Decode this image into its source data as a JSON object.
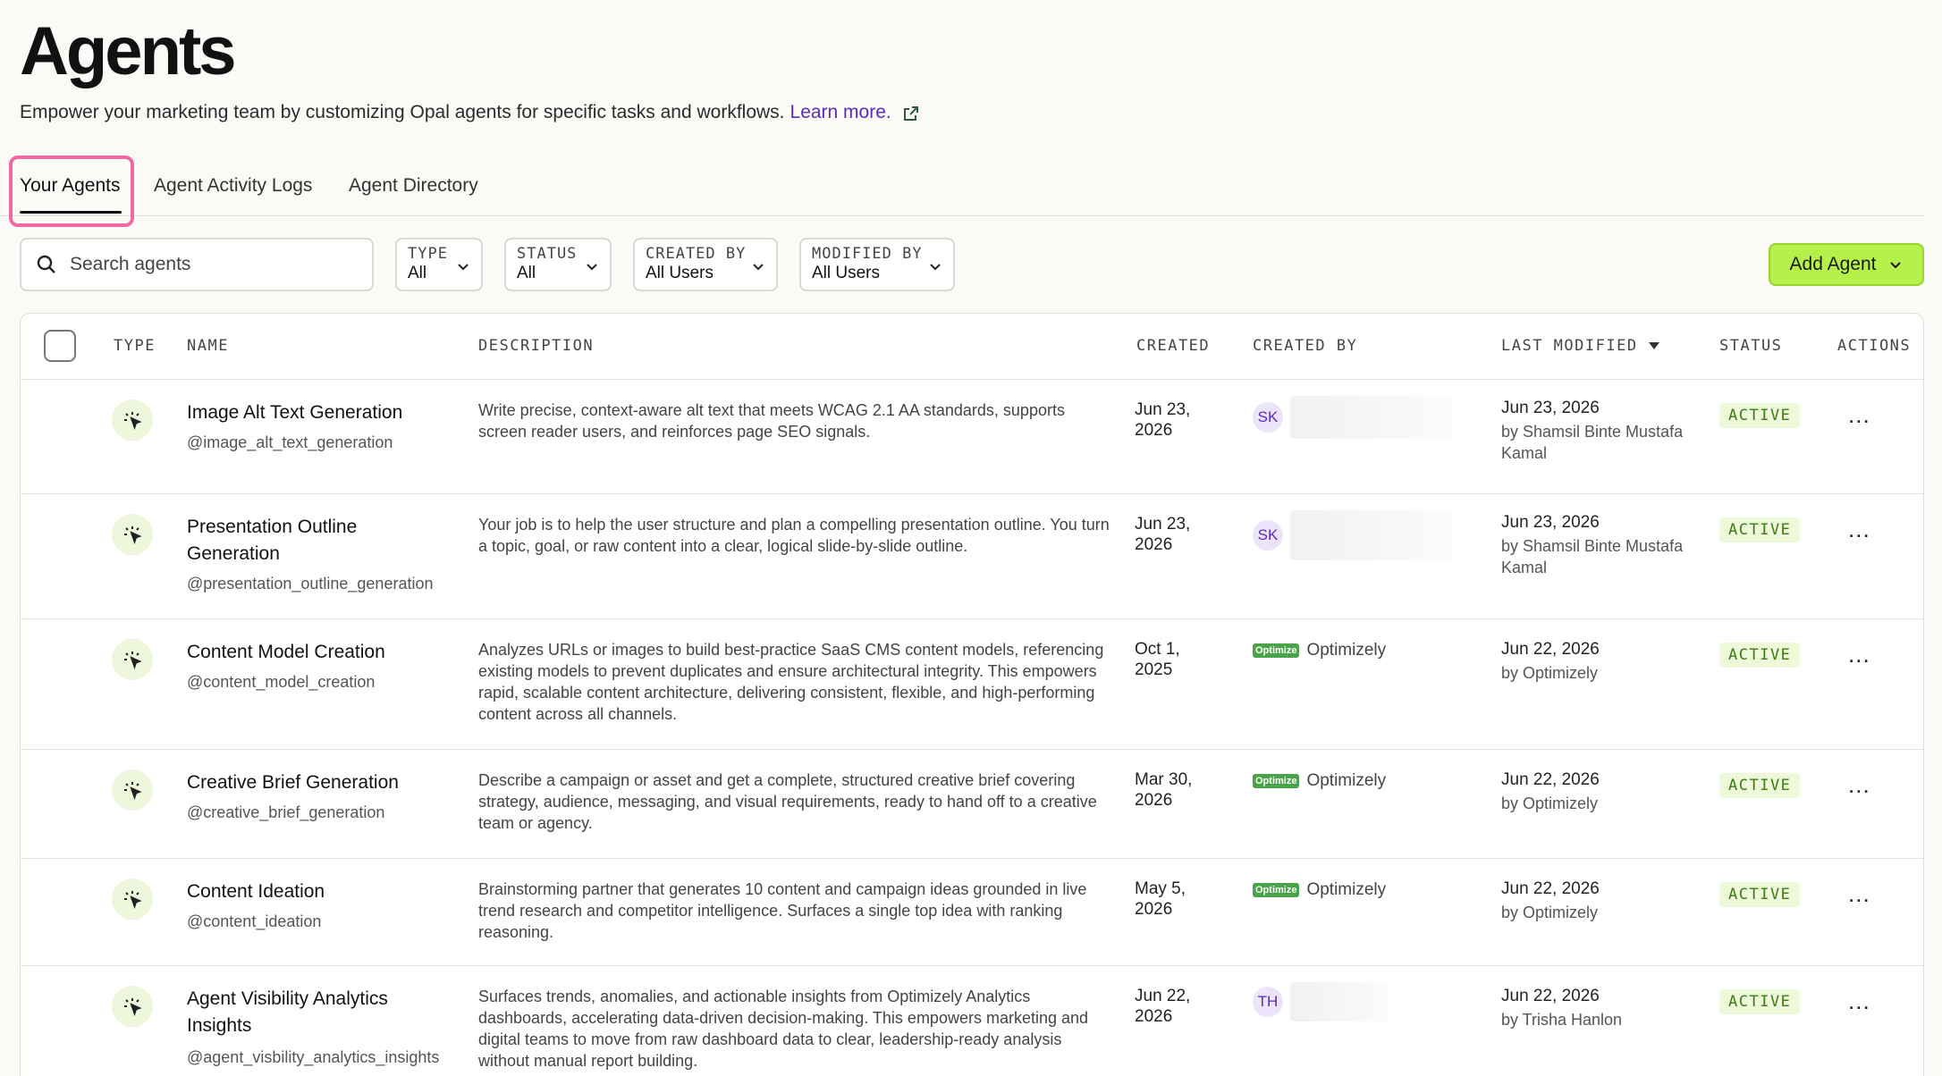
{
  "header": {
    "title": "Agents",
    "subtitle": "Empower your marketing team by customizing Opal agents for specific tasks and workflows.",
    "learn_more": "Learn more."
  },
  "tabs": [
    {
      "label": "Your Agents",
      "active": true
    },
    {
      "label": "Agent Activity Logs",
      "active": false
    },
    {
      "label": "Agent Directory",
      "active": false
    }
  ],
  "search": {
    "placeholder": "Search agents",
    "value": ""
  },
  "filters": [
    {
      "label": "TYPE",
      "value": "All"
    },
    {
      "label": "STATUS",
      "value": "All"
    },
    {
      "label": "CREATED BY",
      "value": "All Users"
    },
    {
      "label": "MODIFIED BY",
      "value": "All Users"
    }
  ],
  "add_button": {
    "label": "Add Agent"
  },
  "table": {
    "columns": {
      "type": "TYPE",
      "name": "NAME",
      "description": "DESCRIPTION",
      "created": "CREATED",
      "created_by": "CREATED BY",
      "last_modified": "LAST MODIFIED",
      "status": "STATUS",
      "actions": "ACTIONS"
    },
    "rows": [
      {
        "name": "Image Alt Text Generation",
        "handle": "@image_alt_text_generation",
        "description": "Write precise, context-aware alt text that meets WCAG 2.1 AA standards, supports screen reader users, and reinforces page SEO signals.",
        "created": "Jun 23, 2026",
        "creator_initials": "SK",
        "modified_date": "Jun 23, 2026",
        "modified_by": "by Shamsil Binte Mustafa Kamal",
        "status": "ACTIVE",
        "actions": "..."
      },
      {
        "name": "Presentation Outline Generation",
        "handle": "@presentation_outline_generation",
        "description": "Your job is to help the user structure and plan a compelling presentation outline. You turn a topic, goal, or raw content into a clear, logical slide-by-slide outline.",
        "created": "Jun 23, 2026",
        "creator_initials": "SK",
        "modified_date": "Jun 23, 2026",
        "modified_by": "by Shamsil Binte Mustafa Kamal",
        "status": "ACTIVE",
        "actions": "..."
      },
      {
        "name": "Content Model Creation",
        "handle": "@content_model_creation",
        "description": "Analyzes URLs or images to build best-practice SaaS CMS content models, referencing existing models to prevent duplicates and ensure architectural integrity. This empowers rapid, scalable content architecture, delivering consistent, flexible, and high-performing content across all channels.",
        "created": "Oct 1, 2025",
        "creator_logo": "Optimize",
        "creator_name": "Optimizely",
        "modified_date": "Jun 22, 2026",
        "modified_by": "by Optimizely",
        "status": "ACTIVE",
        "actions": "..."
      },
      {
        "name": "Creative Brief Generation",
        "handle": "@creative_brief_generation",
        "description": "Describe a campaign or asset and get a complete, structured creative brief covering strategy, audience, messaging, and visual requirements, ready to hand off to a creative team or agency.",
        "created": "Mar 30, 2026",
        "creator_logo": "Optimize",
        "creator_name": "Optimizely",
        "modified_date": "Jun 22, 2026",
        "modified_by": "by Optimizely",
        "status": "ACTIVE",
        "actions": "..."
      },
      {
        "name": "Content Ideation",
        "handle": "@content_ideation",
        "description": "Brainstorming partner that generates 10 content and campaign ideas grounded in live trend research and competitor intelligence. Surfaces a single top idea with ranking reasoning.",
        "created": "May 5, 2026",
        "creator_logo": "Optimize",
        "creator_name": "Optimizely",
        "modified_date": "Jun 22, 2026",
        "modified_by": "by Optimizely",
        "status": "ACTIVE",
        "actions": "..."
      },
      {
        "name": "Agent Visibility Analytics Insights",
        "handle": "@agent_visbility_analytics_insights",
        "description": "Surfaces trends, anomalies, and actionable insights from Optimizely Analytics dashboards, accelerating data-driven decision-making. This empowers marketing and digital teams to move from raw dashboard data to clear, leadership-ready analysis without manual report building.",
        "created": "Jun 22, 2026",
        "creator_initials": "TH",
        "modified_date": "Jun 22, 2026",
        "modified_by": "by Trisha Hanlon",
        "status": "ACTIVE",
        "actions": "..."
      }
    ]
  },
  "icons": {
    "search": "search-icon",
    "external": "external-link-icon",
    "chevron": "chevron-down-icon",
    "agent_type": "sparkle-cursor-icon",
    "sort": "sort-desc-icon"
  },
  "colors": {
    "accent_green": "#b6f04a",
    "link_purple": "#5b2bbf",
    "tab_highlight": "#f06aa5",
    "status_green": "#3a7d10"
  }
}
